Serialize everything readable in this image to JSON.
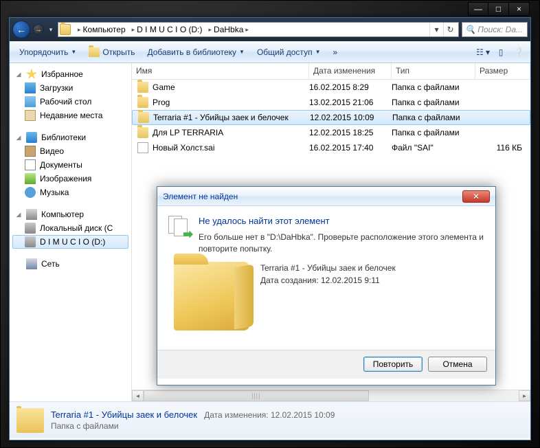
{
  "window": {
    "minimize": "—",
    "maximize": "□",
    "close": "×"
  },
  "nav": {
    "breadcrumbs": [
      "Компьютер",
      "D I M U C I O (D:)",
      "DaHbka"
    ],
    "search_placeholder": "Поиск: Da..."
  },
  "toolbar": {
    "organize": "Упорядочить",
    "open": "Открыть",
    "library": "Добавить в библиотеку",
    "share": "Общий доступ",
    "burn": "»"
  },
  "sidebar": {
    "favorites": {
      "label": "Избранное",
      "items": [
        {
          "label": "Загрузки"
        },
        {
          "label": "Рабочий стол"
        },
        {
          "label": "Недавние места"
        }
      ]
    },
    "libraries": {
      "label": "Библиотеки",
      "items": [
        {
          "label": "Видео"
        },
        {
          "label": "Документы"
        },
        {
          "label": "Изображения"
        },
        {
          "label": "Музыка"
        }
      ]
    },
    "computer": {
      "label": "Компьютер",
      "items": [
        {
          "label": "Локальный диск (C"
        },
        {
          "label": "D I M U C I O (D:)"
        }
      ]
    },
    "network": {
      "label": "Сеть"
    }
  },
  "columns": {
    "name": "Имя",
    "date": "Дата изменения",
    "type": "Тип",
    "size": "Размер"
  },
  "files": [
    {
      "name": "Game",
      "date": "16.02.2015 8:29",
      "type": "Папка с файлами",
      "size": "",
      "kind": "folder"
    },
    {
      "name": "Prog",
      "date": "13.02.2015 21:06",
      "type": "Папка с файлами",
      "size": "",
      "kind": "folder"
    },
    {
      "name": "Terraria #1 - Убийцы заек и белочек",
      "date": "12.02.2015 10:09",
      "type": "Папка с файлами",
      "size": "",
      "kind": "folder",
      "selected": true
    },
    {
      "name": "Для LP TERRARIA",
      "date": "12.02.2015 18:25",
      "type": "Папка с файлами",
      "size": "",
      "kind": "folder"
    },
    {
      "name": "Новый Холст.sai",
      "date": "16.02.2015 17:40",
      "type": "Файл \"SAI\"",
      "size": "116 КБ",
      "kind": "file"
    }
  ],
  "details": {
    "title": "Terraria #1 - Убийцы заек и белочек",
    "meta_label": "Дата изменения:",
    "meta_value": "12.02.2015 10:09",
    "sub": "Папка с файлами"
  },
  "dialog": {
    "title": "Элемент не найден",
    "heading": "Не удалось найти этот элемент",
    "body": "Его больше нет в \"D:\\DaHbka\". Проверьте расположение этого элемента и повторите попытку.",
    "item_name": "Terraria #1 - Убийцы заек и белочек",
    "created_label": "Дата создания: 12.02.2015 9:11",
    "retry": "Повторить",
    "cancel": "Отмена"
  }
}
